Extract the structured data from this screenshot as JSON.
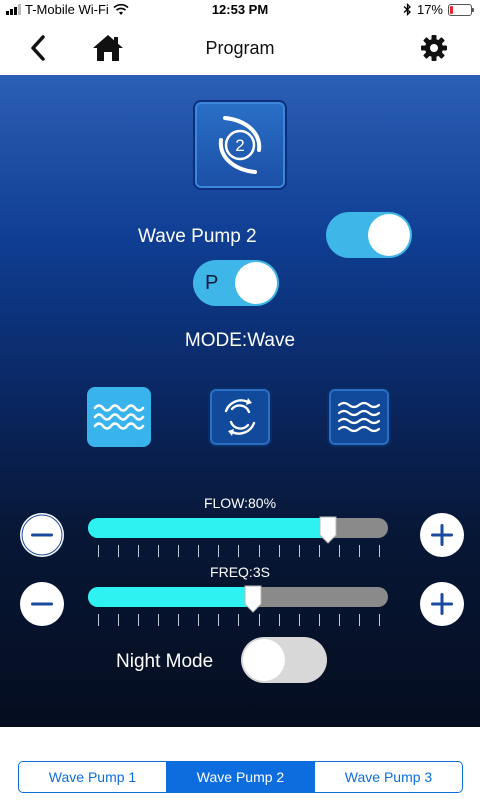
{
  "status_bar": {
    "carrier": "T-Mobile Wi-Fi",
    "time": "12:53 PM",
    "battery": "17%",
    "battery_level": 0.17,
    "battery_color": "#e8262b"
  },
  "header": {
    "title": "Program",
    "back_icon": "back-chevron-icon",
    "home_icon": "home-icon",
    "settings_icon": "gear-icon"
  },
  "pump": {
    "icon_number": "2",
    "name": "Wave Pump 2",
    "enabled": true,
    "p_label": "P",
    "p_enabled": true
  },
  "mode": {
    "label": "MODE:Wave",
    "options": [
      {
        "icon": "wave-mode-icon",
        "selected": true
      },
      {
        "icon": "circulation-mode-icon",
        "selected": false
      },
      {
        "icon": "tide-mode-icon",
        "selected": false
      }
    ]
  },
  "flow": {
    "label": "FLOW:80%",
    "value": 0.8
  },
  "freq": {
    "label": "FREQ:3S",
    "value": 0.55
  },
  "night_mode": {
    "label": "Night Mode",
    "enabled": false
  },
  "tabs": [
    {
      "label": "Wave Pump 1",
      "active": false
    },
    {
      "label": "Wave Pump 2",
      "active": true
    },
    {
      "label": "Wave Pump 3",
      "active": false
    }
  ],
  "colors": {
    "accent": "#3fb6e8",
    "slider_fill": "#2ef2f2",
    "tab_blue": "#0d6dde"
  }
}
